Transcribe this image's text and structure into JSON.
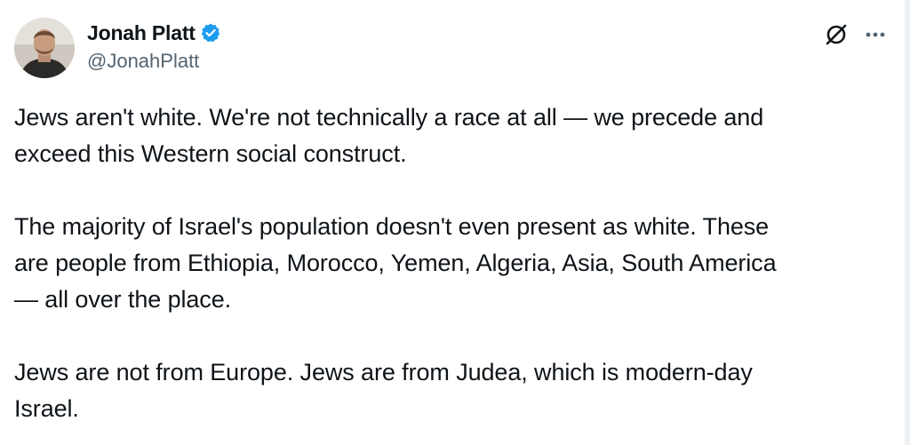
{
  "author": {
    "display_name": "Jonah Platt",
    "handle": "@JonahPlatt",
    "verified": true,
    "avatar_icon": "profile-photo"
  },
  "actions": {
    "grok_icon": "grok-icon",
    "more_icon": "more-options-icon"
  },
  "tweet": {
    "paragraphs": [
      "Jews aren't white. We're not technically a race at all — we precede and\nexceed this Western social construct.",
      "The majority of Israel's population doesn't even present as white. These\nare people from Ethiopia, Morocco, Yemen, Algeria, Asia, South America\n— all over the place.",
      "Jews are not from Europe. Jews are from Judea, which is modern-day\nIsrael."
    ]
  },
  "colors": {
    "text": "#0f1419",
    "secondary_text": "#536471",
    "verified_blue": "#1d9bf0"
  }
}
